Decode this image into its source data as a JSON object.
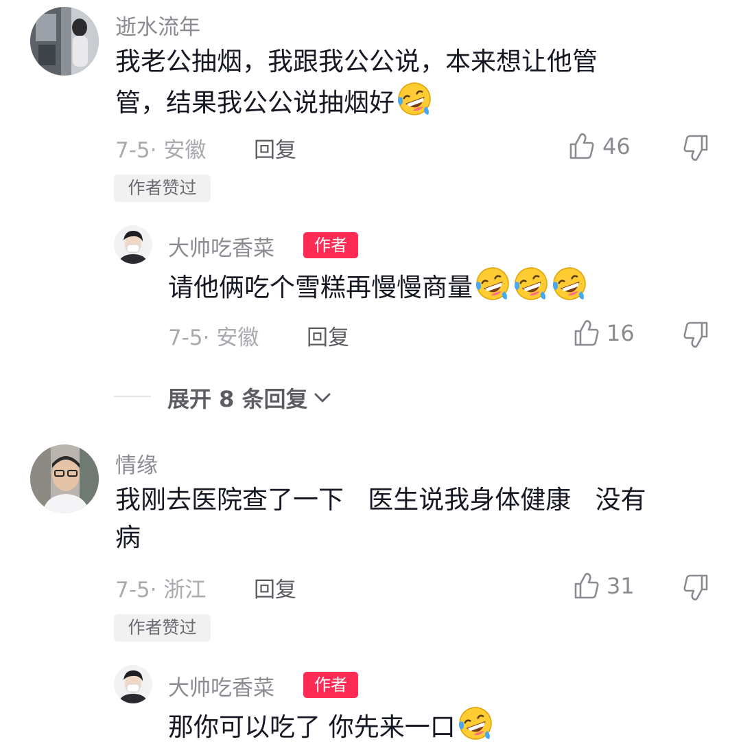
{
  "comments": [
    {
      "username": "逝水流年",
      "text_lines": [
        "我老公抽烟，我跟我公公说，本来想让他管",
        "管，结果我公公说抽烟好"
      ],
      "emoji_count": 1,
      "date_location": "7-5· 安徽",
      "reply_label": "回复",
      "likes": "46",
      "author_liked": "作者赞过",
      "reply": {
        "username": "大帅吃香菜",
        "author_tag": "作者",
        "text": "请他俩吃个雪糕再慢慢商量",
        "emoji_count": 3,
        "date_location": "7-5· 安徽",
        "reply_label": "回复",
        "likes": "16"
      },
      "expand_label": "展开 8 条回复"
    },
    {
      "username": "情缘",
      "text_lines": [
        "我刚去医院查了一下   医生说我身体健康   没有",
        "病"
      ],
      "date_location": "7-5· 浙江",
      "reply_label": "回复",
      "likes": "31",
      "author_liked": "作者赞过",
      "reply": {
        "username": "大帅吃香菜",
        "author_tag": "作者",
        "text": "那你可以吃了 你先来一口",
        "emoji_count": 1
      }
    }
  ],
  "icons": {
    "like": "thumbs-up-icon",
    "dislike": "thumbs-down-icon",
    "emoji": "rolling-on-floor-laughing-emoji",
    "expand": "chevron-down-icon"
  },
  "colors": {
    "author_tag_bg": "#fe2c55",
    "text_primary": "#161823",
    "text_secondary": "#8a8b91"
  }
}
